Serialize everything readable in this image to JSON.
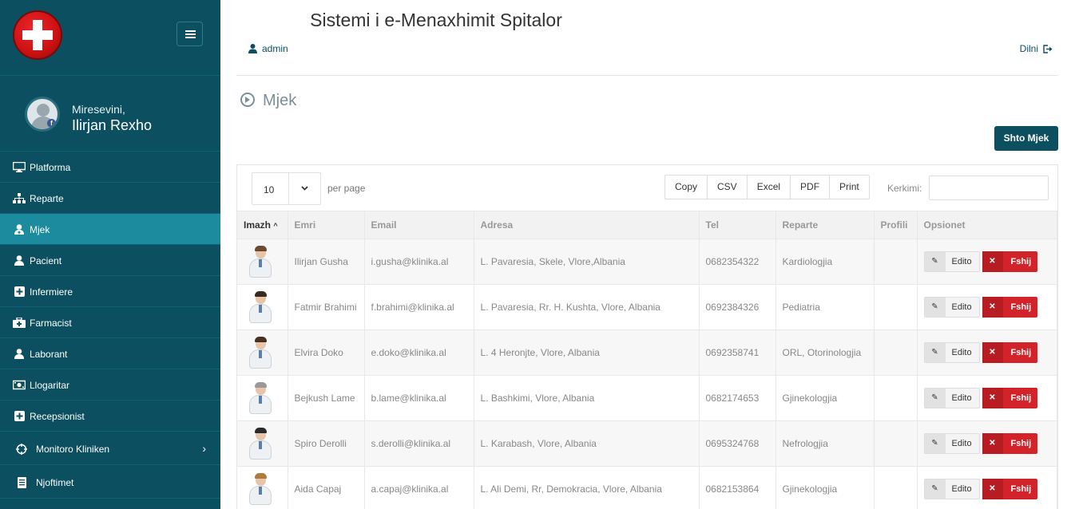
{
  "app": {
    "title": "Sistemi i e-Menaxhimit Spitalor",
    "user": "admin",
    "logout": "Dilni"
  },
  "sidebar": {
    "greeting": "Miresevini,",
    "user_name": "Ilirjan Rexho",
    "items": [
      {
        "label": "Platforma",
        "icon": "monitor-icon",
        "active": false
      },
      {
        "label": "Reparte",
        "icon": "sitemap-icon",
        "active": false
      },
      {
        "label": "Mjek",
        "icon": "user-md-icon",
        "active": true
      },
      {
        "label": "Pacient",
        "icon": "user-icon",
        "active": false
      },
      {
        "label": "Infermiere",
        "icon": "plus-square-icon",
        "active": false
      },
      {
        "label": "Farmacist",
        "icon": "medkit-icon",
        "active": false
      },
      {
        "label": "Laborant",
        "icon": "user-icon",
        "active": false
      },
      {
        "label": "Llogaritar",
        "icon": "money-icon",
        "active": false
      },
      {
        "label": "Recepsionist",
        "icon": "plus-square-icon",
        "active": false
      },
      {
        "label": "Monitoro Kliniken",
        "icon": "crosshair-icon",
        "active": false
      },
      {
        "label": "Njoftimet",
        "icon": "document-icon",
        "active": false
      }
    ]
  },
  "page": {
    "title": "Mjek",
    "add_button": "Shto Mjek"
  },
  "table_controls": {
    "page_length": "10",
    "per_page": "per page",
    "exports": [
      "Copy",
      "CSV",
      "Excel",
      "PDF",
      "Print"
    ],
    "search_label": "Kerkimi:"
  },
  "table": {
    "headers": [
      "Imazh",
      "Emri",
      "Email",
      "Adresa",
      "Tel",
      "Reparte",
      "Profili",
      "Opsionet"
    ],
    "rows": [
      {
        "name": "Ilirjan Gusha",
        "email": "i.gusha@klinika.al",
        "address": "L. Pavaresia, Skele, Vlore,Albania",
        "tel": "0682354322",
        "dept": "Kardiologjia",
        "profile": ""
      },
      {
        "name": "Fatmir Brahimi",
        "email": "f.brahimi@klinika.al",
        "address": "L. Pavaresia, Rr. H. Kushta, Vlore, Albania",
        "tel": "0692384326",
        "dept": "Pediatria",
        "profile": ""
      },
      {
        "name": "Elvira Doko",
        "email": "e.doko@klinika.al",
        "address": "L. 4 Heronjte, Vlore, Albania",
        "tel": "0692358741",
        "dept": "ORL, Otorinologjia",
        "profile": ""
      },
      {
        "name": "Bejkush Lame",
        "email": "b.lame@klinika.al",
        "address": "L. Bashkimi, Vlore, Albania",
        "tel": "0682174653",
        "dept": "Gjinekologjia",
        "profile": ""
      },
      {
        "name": "Spiro Derolli",
        "email": "s.derolli@klinika.al",
        "address": "L. Karabash, Vlore, Albania",
        "tel": "0695324768",
        "dept": "Nefrologjia",
        "profile": ""
      },
      {
        "name": "Aida Capaj",
        "email": "a.capaj@klinika.al",
        "address": "L. Ali Demi, Rr, Demokracia, Vlore, Albania",
        "tel": "0682153864",
        "dept": "Gjinekologjia",
        "profile": ""
      }
    ],
    "edit_label": "Edito",
    "delete_label": "Fshij"
  },
  "colors": {
    "sidebar": "#0b4f60",
    "active": "#1b8b9d",
    "danger": "#d2232a"
  }
}
